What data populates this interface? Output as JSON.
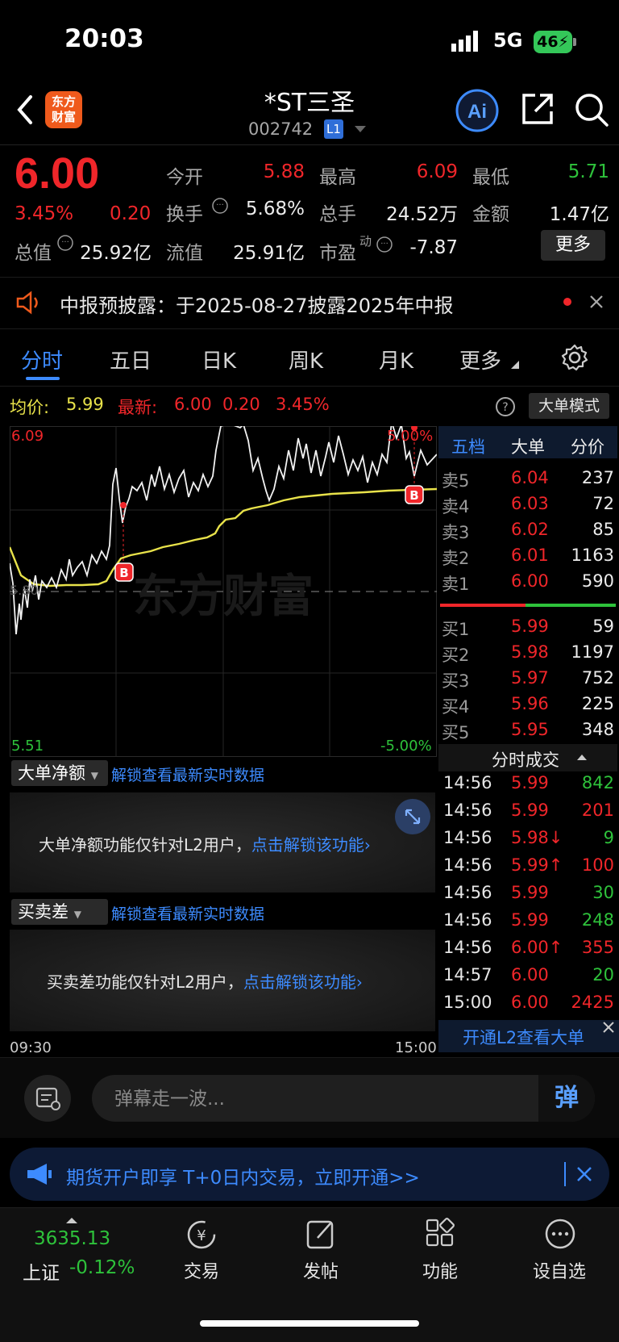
{
  "status": {
    "time": "20:03",
    "network": "5G",
    "battery": "46"
  },
  "header": {
    "logo_line1": "东方",
    "logo_line2": "财富",
    "name": "*ST三圣",
    "code": "002742",
    "level": "L1"
  },
  "quote": {
    "price": "6.00",
    "change_pct": "3.45%",
    "change": "0.20",
    "open_label": "今开",
    "open": "5.88",
    "high_label": "最高",
    "high": "6.09",
    "low_label": "最低",
    "low": "5.71",
    "turnover_label": "换手",
    "turnover": "5.68%",
    "volume_label": "总手",
    "volume": "24.52万",
    "amount_label": "金额",
    "amount": "1.47亿",
    "mcap_label": "总值",
    "mcap": "25.92亿",
    "float_label": "流值",
    "float": "25.91亿",
    "pe_label": "市盈",
    "pe_sup": "动",
    "pe": "-7.87",
    "more": "更多"
  },
  "notice": {
    "text": "中报预披露：于2025-08-27披露2025年中报"
  },
  "tabs": [
    "分时",
    "五日",
    "日K",
    "周K",
    "月K",
    "更多"
  ],
  "chart_info": {
    "avg_label": "均价:",
    "avg": "5.99",
    "latest_label": "最新:",
    "latest": "6.00",
    "chg": "0.20",
    "pct": "3.45%",
    "mode_btn": "大单模式"
  },
  "chart": {
    "y_top": "6.09",
    "y_bottom": "5.51",
    "pct_top": "5.00%",
    "pct_bottom": "-5.00%",
    "t_start": "09:30",
    "t_end": "15:00",
    "watermark": "东方财富",
    "mid_label": "5.80"
  },
  "orderbook": {
    "tabs": [
      "五档",
      "大单",
      "分价"
    ],
    "asks": [
      {
        "label": "卖5",
        "price": "6.04",
        "vol": "237"
      },
      {
        "label": "卖4",
        "price": "6.03",
        "vol": "72"
      },
      {
        "label": "卖3",
        "price": "6.02",
        "vol": "85"
      },
      {
        "label": "卖2",
        "price": "6.01",
        "vol": "1163"
      },
      {
        "label": "卖1",
        "price": "6.00",
        "vol": "590"
      }
    ],
    "bids": [
      {
        "label": "买1",
        "price": "5.99",
        "vol": "59"
      },
      {
        "label": "买2",
        "price": "5.98",
        "vol": "1197"
      },
      {
        "label": "买3",
        "price": "5.97",
        "vol": "752"
      },
      {
        "label": "买4",
        "price": "5.96",
        "vol": "225"
      },
      {
        "label": "买5",
        "price": "5.95",
        "vol": "348"
      }
    ]
  },
  "ticks": {
    "title": "分时成交",
    "rows": [
      {
        "time": "14:56",
        "price": "5.99",
        "vol": "842",
        "dir": "up"
      },
      {
        "time": "14:56",
        "price": "5.99",
        "vol": "201",
        "dir": "down"
      },
      {
        "time": "14:56",
        "price": "5.98↓",
        "vol": "9",
        "dir": "up"
      },
      {
        "time": "14:56",
        "price": "5.99↑",
        "vol": "100",
        "dir": "down"
      },
      {
        "time": "14:56",
        "price": "5.99",
        "vol": "30",
        "dir": "up"
      },
      {
        "time": "14:56",
        "price": "5.99",
        "vol": "248",
        "dir": "up"
      },
      {
        "time": "14:56",
        "price": "6.00↑",
        "vol": "355",
        "dir": "down"
      },
      {
        "time": "14:57",
        "price": "6.00",
        "vol": "20",
        "dir": "up"
      },
      {
        "time": "15:00",
        "price": "6.00",
        "vol": "2425",
        "dir": "down"
      }
    ],
    "l2_banner": "开通L2查看大单"
  },
  "panels": {
    "net_label": "大单净额",
    "net_unlock": "解锁查看最新实时数据",
    "net_msg": "大单净额功能仅针对L2用户，",
    "net_link": "点击解锁该功能›",
    "diff_label": "买卖差",
    "diff_unlock": "解锁查看最新实时数据",
    "diff_msg": "买卖差功能仅针对L2用户，",
    "diff_link": "点击解锁该功能›"
  },
  "comment": {
    "placeholder": "弹幕走一波...",
    "danmu_btn": "弹"
  },
  "ad": {
    "text": "期货开户即享 T+0日内交易，立即开通>>"
  },
  "bottom_nav": {
    "index_value": "3635.13",
    "index_name": "上证",
    "index_change": "-0.12%",
    "items": [
      "交易",
      "发帖",
      "功能",
      "设自选"
    ]
  },
  "colors": {
    "up": "#f0262a",
    "down": "#2ec23b",
    "accent": "#3d8bff",
    "avg_line": "#e8e24a"
  }
}
